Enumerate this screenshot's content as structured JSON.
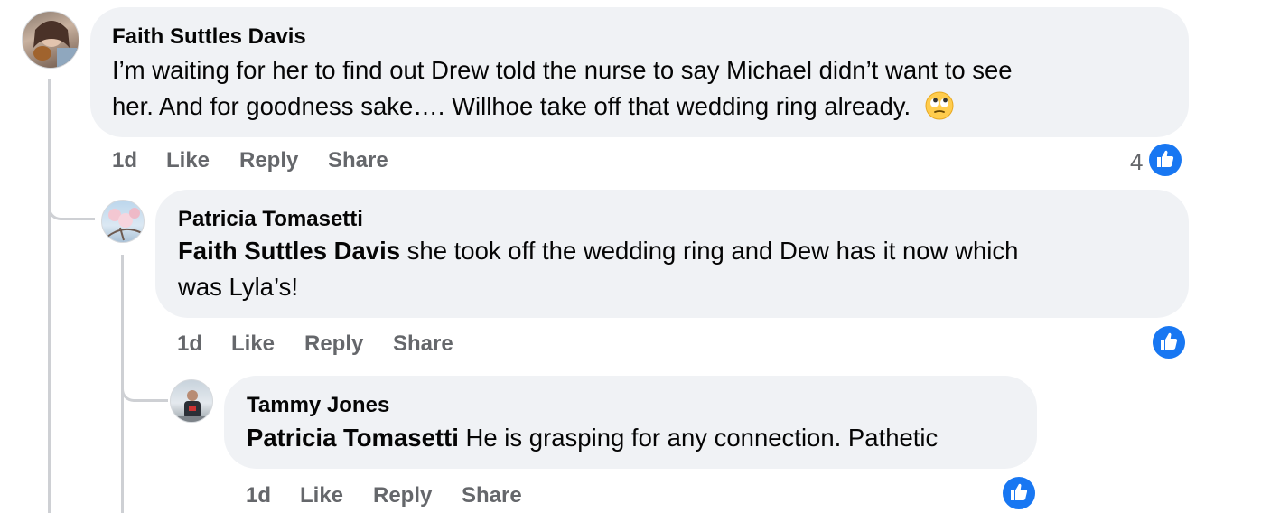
{
  "comments": [
    {
      "author": "Faith Suttles Davis",
      "text_line1": "I’m waiting for her to find out Drew told the nurse to say Michael didn’t want to see",
      "text_line2": "her. And for goodness sake…. Willhoe take off that wedding ring already.",
      "emoji_icon": "face-with-rolling-eyes-icon",
      "time": "1d",
      "like_label": "Like",
      "reply_label": "Reply",
      "share_label": "Share",
      "reaction_count": "4",
      "reaction_icon": "like-reaction-icon"
    },
    {
      "author": "Patricia Tomasetti",
      "mention": "Faith Suttles Davis",
      "text_line1": " she took off the wedding ring and Dew has it now which",
      "text_line2": "was Lyla’s!",
      "time": "1d",
      "like_label": "Like",
      "reply_label": "Reply",
      "share_label": "Share",
      "reaction_icon": "like-reaction-icon"
    },
    {
      "author": "Tammy Jones",
      "mention": "Patricia Tomasetti",
      "text_line1": " He is grasping for any connection. Pathetic",
      "time": "1d",
      "like_label": "Like",
      "reply_label": "Reply",
      "share_label": "Share",
      "reaction_icon": "like-reaction-icon"
    }
  ],
  "colors": {
    "bubble": "#f0f2f5",
    "secondary_text": "#65676b",
    "like_blue": "#1877f2",
    "thread_line": "#ced0d4"
  }
}
